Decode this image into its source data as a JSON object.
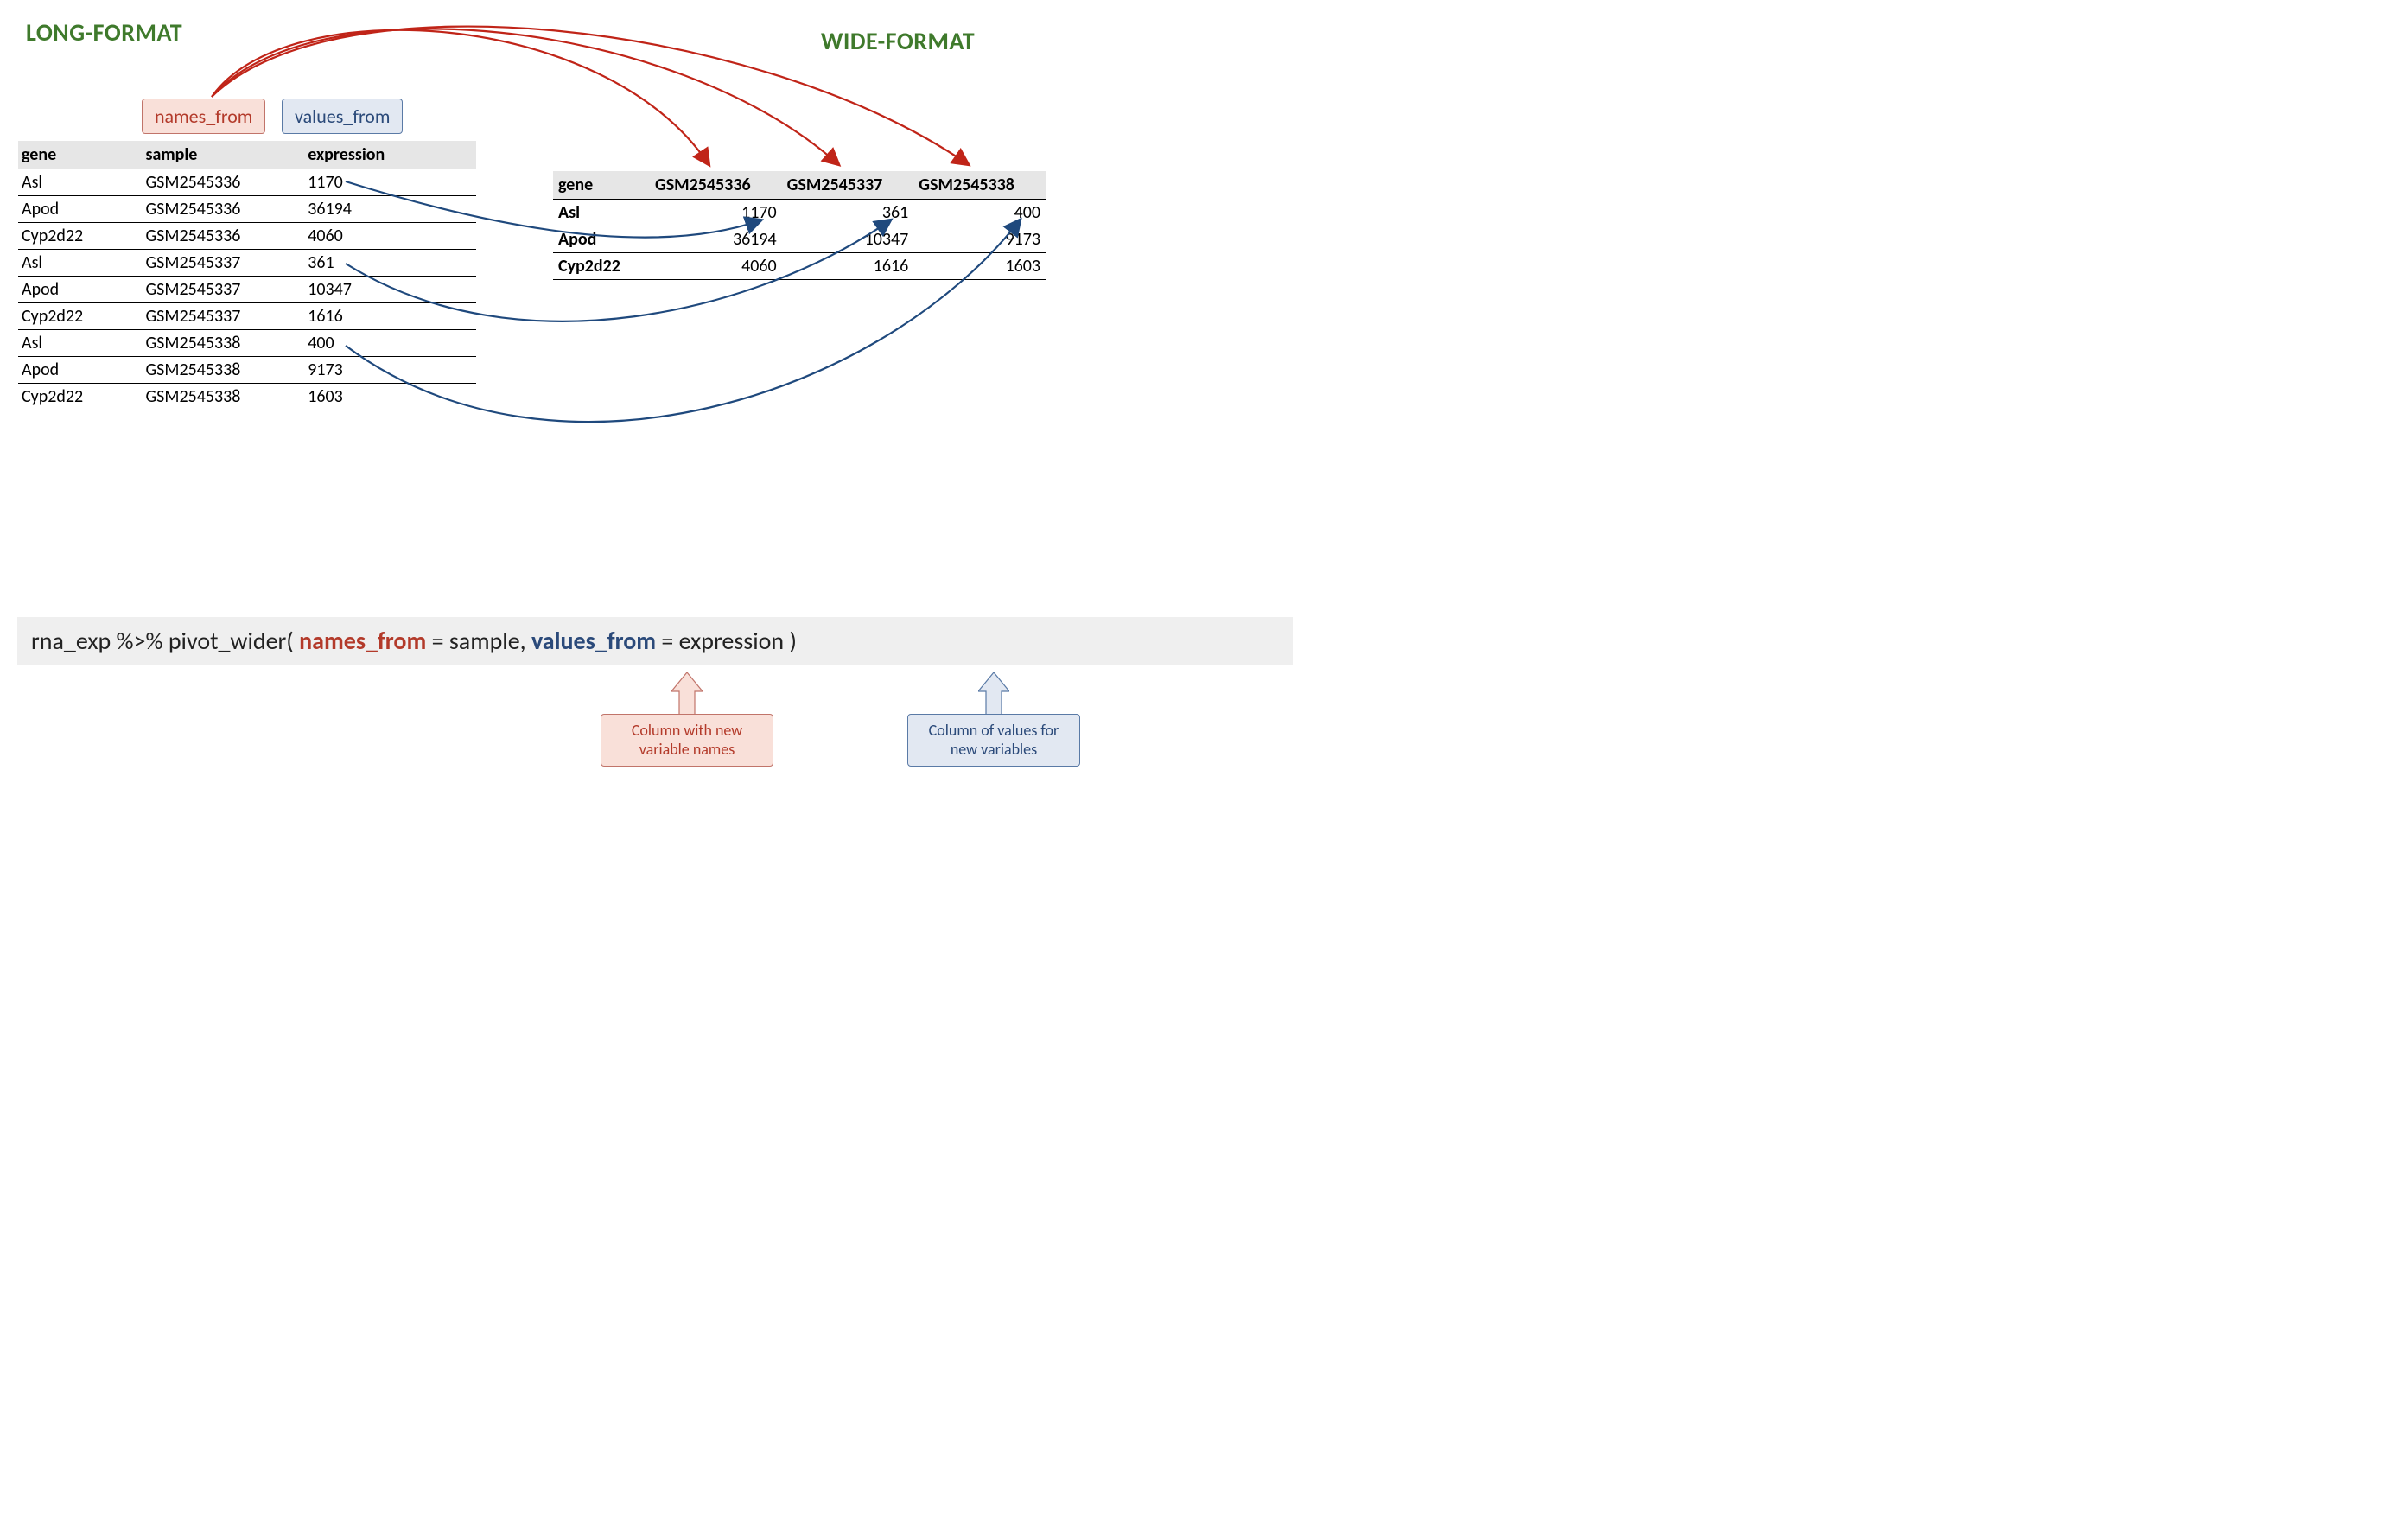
{
  "headings": {
    "long": "LONG-FORMAT",
    "wide": "WIDE-FORMAT"
  },
  "badges": {
    "names": "names_from",
    "values": "values_from"
  },
  "long_table": {
    "headers": [
      "gene",
      "sample",
      "expression"
    ],
    "rows": [
      [
        "Asl",
        "GSM2545336",
        "1170"
      ],
      [
        "Apod",
        "GSM2545336",
        "36194"
      ],
      [
        "Cyp2d22",
        "GSM2545336",
        "4060"
      ],
      [
        "Asl",
        "GSM2545337",
        "361"
      ],
      [
        "Apod",
        "GSM2545337",
        "10347"
      ],
      [
        "Cyp2d22",
        "GSM2545337",
        "1616"
      ],
      [
        "Asl",
        "GSM2545338",
        "400"
      ],
      [
        "Apod",
        "GSM2545338",
        "9173"
      ],
      [
        "Cyp2d22",
        "GSM2545338",
        "1603"
      ]
    ]
  },
  "wide_table": {
    "headers": [
      "gene",
      "GSM2545336",
      "GSM2545337",
      "GSM2545338"
    ],
    "rows": [
      [
        "Asl",
        "1170",
        "361",
        "400"
      ],
      [
        "Apod",
        "36194",
        "10347",
        "9173"
      ],
      [
        "Cyp2d22",
        "4060",
        "1616",
        "1603"
      ]
    ]
  },
  "code": {
    "p1": "rna_exp   %>%   pivot_wider( ",
    "names_from": "names_from",
    "p2": "  =  sample,   ",
    "values_from": "values_from",
    "p3": "  =  expression )"
  },
  "callouts": {
    "red": "Column with new variable names",
    "blue": "Column of values for new variables"
  },
  "colors": {
    "red": "#c02418",
    "blue": "#1f497d",
    "green": "#3f7a2c"
  }
}
